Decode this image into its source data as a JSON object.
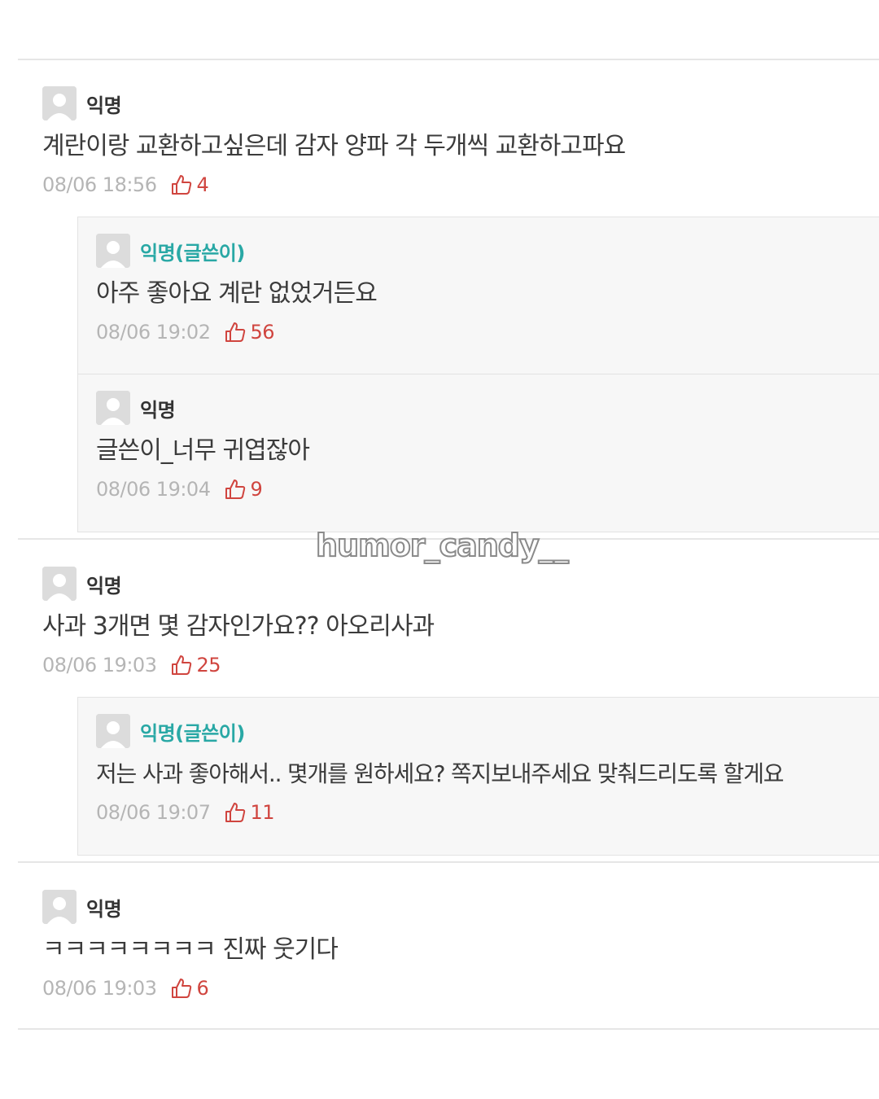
{
  "comments": [
    {
      "author": "익명",
      "text": "계란이랑 교환하고싶은데 감자 양파 각 두개씩 교환하고파요",
      "time": "08/06 18:56",
      "likes": "4",
      "replies": [
        {
          "author": "익명(글쓴이)",
          "text": "아주 좋아요 계란 없었거든요",
          "time": "08/06 19:02",
          "likes": "56"
        },
        {
          "author": "익명",
          "text": "글쓴이_너무 귀엽잖아",
          "time": "08/06 19:04",
          "likes": "9"
        }
      ]
    },
    {
      "author": "익명",
      "text": "사과 3개면 몇 감자인가요?? 아오리사과",
      "time": "08/06 19:03",
      "likes": "25",
      "replies": [
        {
          "author": "익명(글쓴이)",
          "text": "저는 사과 좋아해서.. 몇개를 원하세요? 쪽지보내주세요 맞춰드리도록 할게요",
          "time": "08/06 19:07",
          "likes": "11"
        }
      ]
    },
    {
      "author": "익명",
      "text": "ㅋㅋㅋㅋㅋㅋㅋㅋ 진짜 웃기다",
      "time": "08/06 19:03",
      "likes": "6",
      "replies": []
    }
  ],
  "watermark": "humor_candy__",
  "colors": {
    "author_highlight": "#29a8a5",
    "like_count": "#d0453f",
    "meta_text": "#b5b5b5",
    "reply_bg": "#f7f7f7"
  },
  "icons": {
    "avatar": "default-profile-icon",
    "like": "thumbs-up-icon"
  }
}
